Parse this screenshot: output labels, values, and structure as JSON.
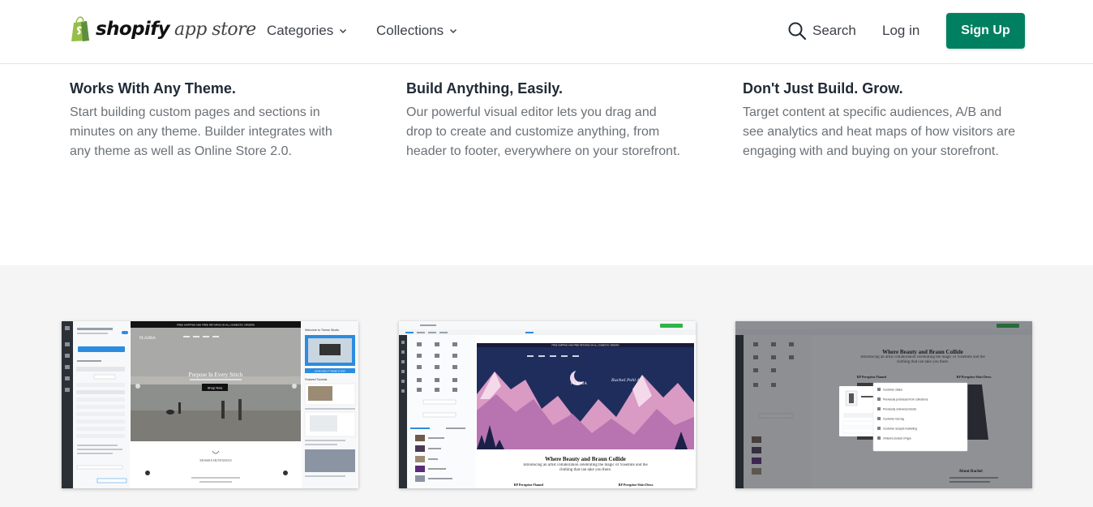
{
  "header": {
    "logo_word": "shopify",
    "logo_sub": "app store",
    "nav": [
      {
        "label": "Categories"
      },
      {
        "label": "Collections"
      }
    ],
    "search_label": "Search",
    "login_label": "Log in",
    "signup_label": "Sign Up",
    "brand_color": "#008060"
  },
  "features": [
    {
      "title": "Works With Any Theme.",
      "body": "Start building custom pages and sections in minutes on any theme. Builder integrates with any theme as well as Online Store 2.0."
    },
    {
      "title": "Build Anything, Easily.",
      "body": "Our powerful visual editor lets you drag and drop to create and customize anything, from header to footer, everywhere on your storefront."
    },
    {
      "title": "Don't Just Build. Grow.",
      "body": "Target content at specific audiences, A/B and see analytics and heat maps of how visitors are engaging with and buying on your storefront."
    }
  ],
  "screenshots": {
    "one": {
      "announcement": "FREE SHIPPING AND FREE RETURNS ON ALL DOMESTIC ORDERS",
      "brand": "PLADRA",
      "hero_title": "Purpose In Every Stitch",
      "hero_button": "Shop Now",
      "hunter": "MOSSES HUNTSMAN",
      "panel_title": "Welcome to Theme Studio",
      "panel_section": "Featured Tutorials",
      "panel_cta": "LEARN ABOUT THEME STUDIO"
    },
    "two": {
      "announcement": "FREE SHIPPING AND FREE RETURNS ON ALL DOMESTIC ORDERS",
      "brand": "PLADRA",
      "collab": "Rachel Pohl Art",
      "headline": "Where Beauty and Braun Collide",
      "subline": "Introducing an artist collaboration celebrating the magic of Yosemite and the clothing that can take you there.",
      "product_left": "RP Peregrine Flannel",
      "product_right": "RP Peregrine Shirt Dress"
    },
    "three": {
      "headline": "Where Beauty and Braun Collide",
      "subline": "Introducing an artist collaboration celebrating the magic of Yosemite and the clothing that can take you there.",
      "product_left": "RP Peregrine Flannel",
      "product_right": "RP Peregrine Shirt Dress",
      "about": "About Rachel",
      "menu": [
        "Customer status",
        "Previously purchased from collections",
        "Previously ordered products",
        "Customer has tag",
        "Customer accepts marketing",
        "Ordered product of type"
      ]
    }
  }
}
